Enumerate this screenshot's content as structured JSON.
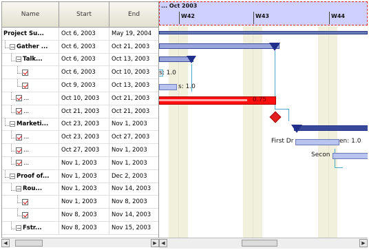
{
  "table": {
    "columns": [
      "Name",
      "Start",
      "End"
    ],
    "rows": [
      {
        "name": "Project Su...",
        "start": "Oct 6, 2003",
        "end": "May 19, 2004",
        "level": 0,
        "type": "summary"
      },
      {
        "name": "Gather ...",
        "start": "Oct 6, 2003",
        "end": "Oct 21, 2003",
        "level": 1,
        "type": "group"
      },
      {
        "name": "Talk...",
        "start": "Oct 6, 2003",
        "end": "Oct 13, 2003",
        "level": 2,
        "type": "group"
      },
      {
        "name": "",
        "start": "Oct 6, 2003",
        "end": "Oct 10, 2003",
        "level": 3,
        "type": "task"
      },
      {
        "name": "",
        "start": "Oct 9, 2003",
        "end": "Oct 13, 2003",
        "level": 3,
        "type": "task"
      },
      {
        "name": "...",
        "start": "Oct 10, 2003",
        "end": "Oct 21, 2003",
        "level": 2,
        "type": "task"
      },
      {
        "name": "...",
        "start": "Oct 21, 2003",
        "end": "Oct 21, 2003",
        "level": 2,
        "type": "task"
      },
      {
        "name": "Marketi...",
        "start": "Oct 23, 2003",
        "end": "Nov 1, 2003",
        "level": 1,
        "type": "group"
      },
      {
        "name": "...",
        "start": "Oct 23, 2003",
        "end": "Oct 27, 2003",
        "level": 2,
        "type": "task"
      },
      {
        "name": "...",
        "start": "Oct 27, 2003",
        "end": "Nov 1, 2003",
        "level": 2,
        "type": "task"
      },
      {
        "name": "...",
        "start": "Nov 1, 2003",
        "end": "Nov 1, 2003",
        "level": 2,
        "type": "task"
      },
      {
        "name": "Proof of...",
        "start": "Nov 1, 2003",
        "end": "Dec 2, 2003",
        "level": 1,
        "type": "group"
      },
      {
        "name": "Rou...",
        "start": "Nov 1, 2003",
        "end": "Nov 14, 2003",
        "level": 2,
        "type": "group"
      },
      {
        "name": "",
        "start": "Nov 1, 2003",
        "end": "Nov 8, 2003",
        "level": 3,
        "type": "task"
      },
      {
        "name": "",
        "start": "Nov 8, 2003",
        "end": "Nov 14, 2003",
        "level": 3,
        "type": "task"
      },
      {
        "name": "Fstr...",
        "start": "Nov 8, 2003",
        "end": "Nov 15, 2003",
        "level": 2,
        "type": "group"
      }
    ]
  },
  "gantt": {
    "month_label": "... Oct 2003",
    "weeks": [
      "W42",
      "W43",
      "W44"
    ],
    "labels": {
      "task_a": "1.0",
      "task_b": "1.0",
      "progress": "0.75",
      "first_draft": "First Dr",
      "first_draft_tail": "en: 1.0",
      "second": "Secon"
    }
  },
  "colors": {
    "header_bg": "#cfd0ff",
    "bar_fill": "#b8c4ee",
    "summary_fill": "#3a4a9a",
    "progress_red": "#ff1010",
    "milestone": "#e02020",
    "connector": "#4aa8c8"
  }
}
